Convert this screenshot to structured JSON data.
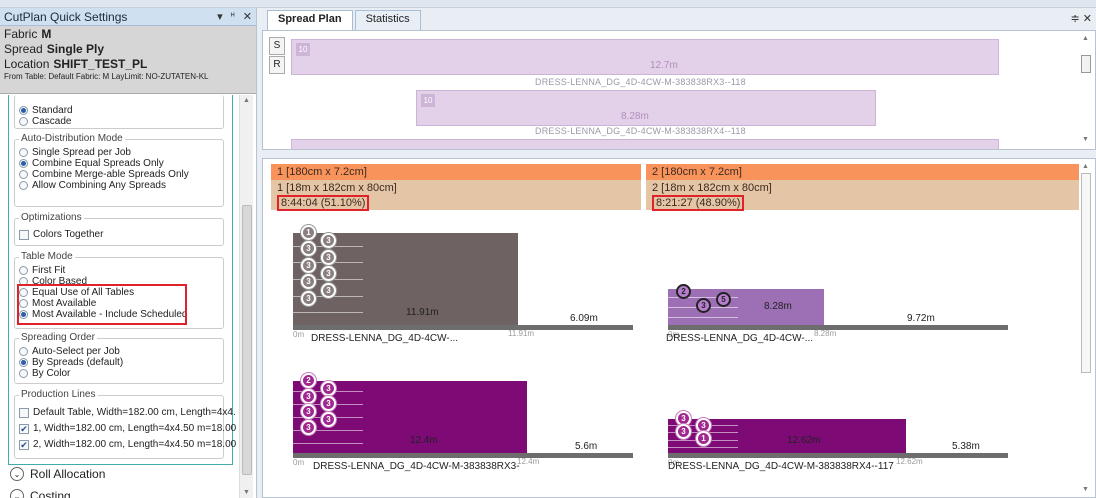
{
  "quick_settings": {
    "title": "CutPlan Quick Settings",
    "fabric_label": "Fabric",
    "fabric_value": "M",
    "spread_label": "Spread",
    "spread_value": "Single Ply",
    "location_label": "Location",
    "location_value": "SHIFT_TEST_PL",
    "from_table": "From Table: Default Fabric: M LayLimit: NO-ZUTATEN-KL"
  },
  "cascade_group": {
    "options": [
      "Standard",
      "Cascade"
    ],
    "selected": "Standard"
  },
  "auto_distribution": {
    "title": "Auto-Distribution Mode",
    "options": [
      "Single Spread per Job",
      "Combine Equal Spreads Only",
      "Combine Merge-able Spreads Only",
      "Allow Combining Any Spreads"
    ],
    "selected": "Combine Equal Spreads Only"
  },
  "optimizations": {
    "title": "Optimizations",
    "colors_together": "Colors Together"
  },
  "table_mode": {
    "title": "Table Mode",
    "options": [
      "First Fit",
      "Color Based",
      "Equal Use of All Tables",
      "Most Available",
      "Most Available - Include Scheduled"
    ],
    "selected": "Most Available - Include Scheduled"
  },
  "spreading_order": {
    "title": "Spreading Order",
    "options": [
      "Auto-Select per Job",
      "By Spreads (default)",
      "By Color"
    ],
    "selected": "By Spreads (default)"
  },
  "production_lines": {
    "title": "Production Lines",
    "items": [
      {
        "label": "Default Table, Width=182.00 cm, Length=4x4.",
        "checked": false
      },
      {
        "label": "1, Width=182.00 cm, Length=4x4.50 m=18.00",
        "checked": true
      },
      {
        "label": "2, Width=182.00 cm, Length=4x4.50 m=18.00",
        "checked": true
      }
    ]
  },
  "expanders": {
    "roll_allocation": "Roll Allocation",
    "costing": "Costing"
  },
  "tabs": {
    "spread_plan": "Spread Plan",
    "statistics": "Statistics"
  },
  "upper": {
    "s_button": "S",
    "r_button": "R",
    "plans": [
      {
        "badge": "10",
        "length": "12.7m",
        "name": "DRESS-LENNA_DG_4D-4CW-M-383838RX3--118"
      },
      {
        "badge": "10",
        "length": "8.28m",
        "name": "DRESS-LENNA_DG_4D-4CW-M-383838RX4--118"
      }
    ]
  },
  "tables": [
    {
      "header1": "1 [180cm x 7.2cm]",
      "header2": "1 [18m x 182cm x 80cm]",
      "time": "8:44:04 (51.10%)",
      "spreads": [
        {
          "used": "11.91m",
          "remain": "6.09m",
          "start": "0m",
          "end": "11.91m",
          "name": "DRESS-LENNA_DG_4D-4CW-...",
          "color": "#6e6262",
          "fraction": 0.6617,
          "bubbles": [
            "1",
            "3",
            "3",
            "3",
            "3",
            "3",
            "3",
            "3",
            "3"
          ]
        },
        {
          "used": "12.4m",
          "remain": "5.6m",
          "start": "0m",
          "end": "12.4m",
          "name": "DRESS-LENNA_DG_4D-4CW-M-383838RX3-",
          "color": "#7d0a75",
          "fraction": 0.6889,
          "bubbles": [
            "2",
            "3",
            "3",
            "3",
            "3",
            "3",
            "3"
          ]
        }
      ]
    },
    {
      "header1": "2 [180cm x 7.2cm]",
      "header2": "2 [18m x 182cm x 80cm]",
      "time": "8:21:27 (48.90%)",
      "spreads": [
        {
          "used": "8.28m",
          "remain": "9.72m",
          "start": "0m",
          "end": "8.28m",
          "name": "DRESS-LENNA_DG_4D-4CW-...",
          "color": "#9d6fb4",
          "fraction": 0.46,
          "bubbles": [
            "2",
            "3",
            "5"
          ]
        },
        {
          "used": "12.62m",
          "remain": "5.38m",
          "start": "0m",
          "end": "12.62m",
          "name": "DRESS-LENNA_DG_4D-4CW-M-383838RX4--117",
          "color": "#7d0a75",
          "fraction": 0.7011,
          "bubbles": [
            "3",
            "3",
            "3",
            "1"
          ]
        }
      ]
    }
  ]
}
